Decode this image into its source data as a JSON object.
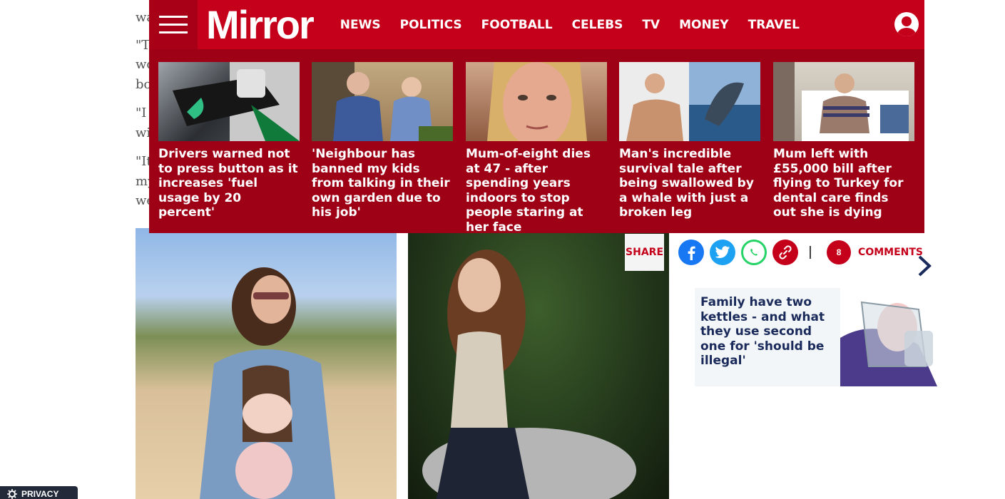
{
  "article": {
    "para1_tail": "wa",
    "para2_start": "\"T",
    "para2_l2": "wo",
    "para2_l3": "bo",
    "para3_start": "\"I",
    "para3_l2": "wi",
    "para4_start": "\"It",
    "para4_l2": "my",
    "para4_l3": "we"
  },
  "nav": {
    "logo": "Mirror",
    "links": [
      "NEWS",
      "POLITICS",
      "FOOTBALL",
      "CELEBS",
      "TV",
      "MONEY",
      "TRAVEL"
    ]
  },
  "stories": [
    {
      "title": "Drivers warned not to press button as it increases 'fuel usage by 20 percent'",
      "image": "fuel-pump-photo"
    },
    {
      "title": "'Neighbour has banned my kids from talking in their own garden due to his job'",
      "image": "neighbours-arguing-photo"
    },
    {
      "title": "Mum-of-eight dies at 47 - after spending years indoors to stop people staring at her face",
      "image": "woman-portrait-photo"
    },
    {
      "title": "Man's incredible survival tale after being swallowed by a whale with just a broken leg",
      "image": "man-in-hospital-and-whale-photo"
    },
    {
      "title": "Mum left with £55,000 bill after flying to Turkey for dental care finds out she is dying",
      "image": "woman-in-hospital-bed-photo"
    }
  ],
  "share": {
    "label": "SHARE",
    "comment_count": "8",
    "comments_label": "COMMENTS"
  },
  "recommended": {
    "title": "Family have two kettles - and what they use second one for 'should be illegal'"
  },
  "privacy": {
    "label": "PRIVACY"
  },
  "colors": {
    "brand_red": "#c5001a",
    "panel_red": "#9e0015",
    "facebook": "#1877f2",
    "twitter": "#1da1f2",
    "whatsapp": "#25d366"
  }
}
